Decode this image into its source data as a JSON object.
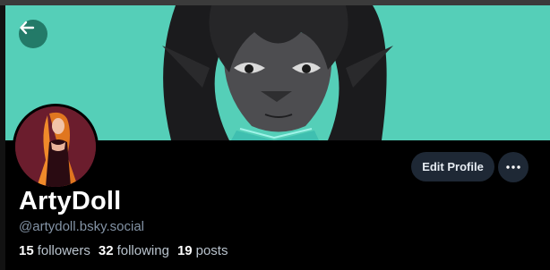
{
  "profile": {
    "display_name": "ArtyDoll",
    "handle": "@artydoll.bsky.social",
    "followers_count": "15",
    "followers_label": "followers",
    "following_count": "32",
    "following_label": "following",
    "posts_count": "19",
    "posts_label": "posts"
  },
  "actions": {
    "edit_profile_label": "Edit Profile"
  },
  "icons": {
    "back": "arrow-left-icon",
    "more": "ellipsis-icon"
  },
  "colors": {
    "banner_bg": "#55cfb8",
    "button_bg": "#1e2835",
    "page_bg": "#000000"
  }
}
